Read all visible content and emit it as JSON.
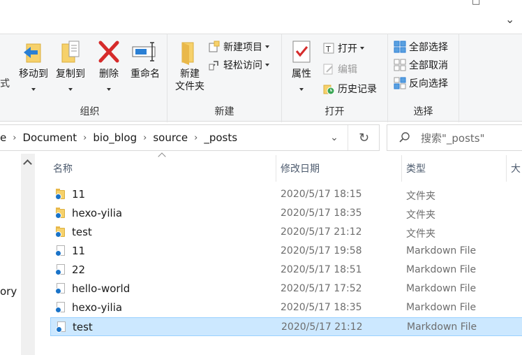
{
  "window": {
    "maximize_glyph": "□",
    "close_glyph": "⌄"
  },
  "ribbon": {
    "organize": {
      "label": "组织",
      "move_to": "移动到",
      "copy_to": "复制到",
      "delete": "删除",
      "rename": "重命名"
    },
    "new": {
      "label": "新建",
      "new_folder_line1": "新建",
      "new_folder_line2": "文件夹",
      "new_item": "新建项目",
      "easy_access": "轻松访问"
    },
    "open": {
      "label": "打开",
      "properties": "属性",
      "open": "打开",
      "edit": "编辑",
      "history": "历史记录"
    },
    "select": {
      "label": "选择",
      "select_all": "全部选择",
      "select_none": "全部取消",
      "invert": "反向选择"
    },
    "left_cut_text": "式"
  },
  "address": {
    "crumbs": [
      "e",
      "Document",
      "bio_blog",
      "source",
      "_posts"
    ],
    "separator": "›",
    "dropdown_glyph": "⌄",
    "refresh_glyph": "↻"
  },
  "search": {
    "placeholder": "搜索\"_posts\""
  },
  "nav": {
    "partial_label": "ory"
  },
  "columns": {
    "name": "名称",
    "modified": "修改日期",
    "type": "类型",
    "size_partial": "大"
  },
  "files": [
    {
      "name": "11",
      "date": "2020/5/17 18:15",
      "type": "文件夹",
      "kind": "folder",
      "selected": false
    },
    {
      "name": "hexo-yilia",
      "date": "2020/5/17 18:35",
      "type": "文件夹",
      "kind": "folder",
      "selected": false
    },
    {
      "name": "test",
      "date": "2020/5/17 21:12",
      "type": "文件夹",
      "kind": "folder",
      "selected": false
    },
    {
      "name": "11",
      "date": "2020/5/17 19:58",
      "type": "Markdown File",
      "kind": "file",
      "selected": false
    },
    {
      "name": "22",
      "date": "2020/5/17 18:51",
      "type": "Markdown File",
      "kind": "file",
      "selected": false
    },
    {
      "name": "hello-world",
      "date": "2020/5/17 17:52",
      "type": "Markdown File",
      "kind": "file",
      "selected": false
    },
    {
      "name": "hexo-yilia",
      "date": "2020/5/17 18:35",
      "type": "Markdown File",
      "kind": "file",
      "selected": false
    },
    {
      "name": "test",
      "date": "2020/5/17 21:12",
      "type": "Markdown File",
      "kind": "file",
      "selected": true
    }
  ],
  "colors": {
    "selection_bg": "#cce8ff",
    "selection_border": "#99d1ff",
    "ribbon_bg": "#f5f6f7",
    "accent_blue": "#1a73c8"
  }
}
